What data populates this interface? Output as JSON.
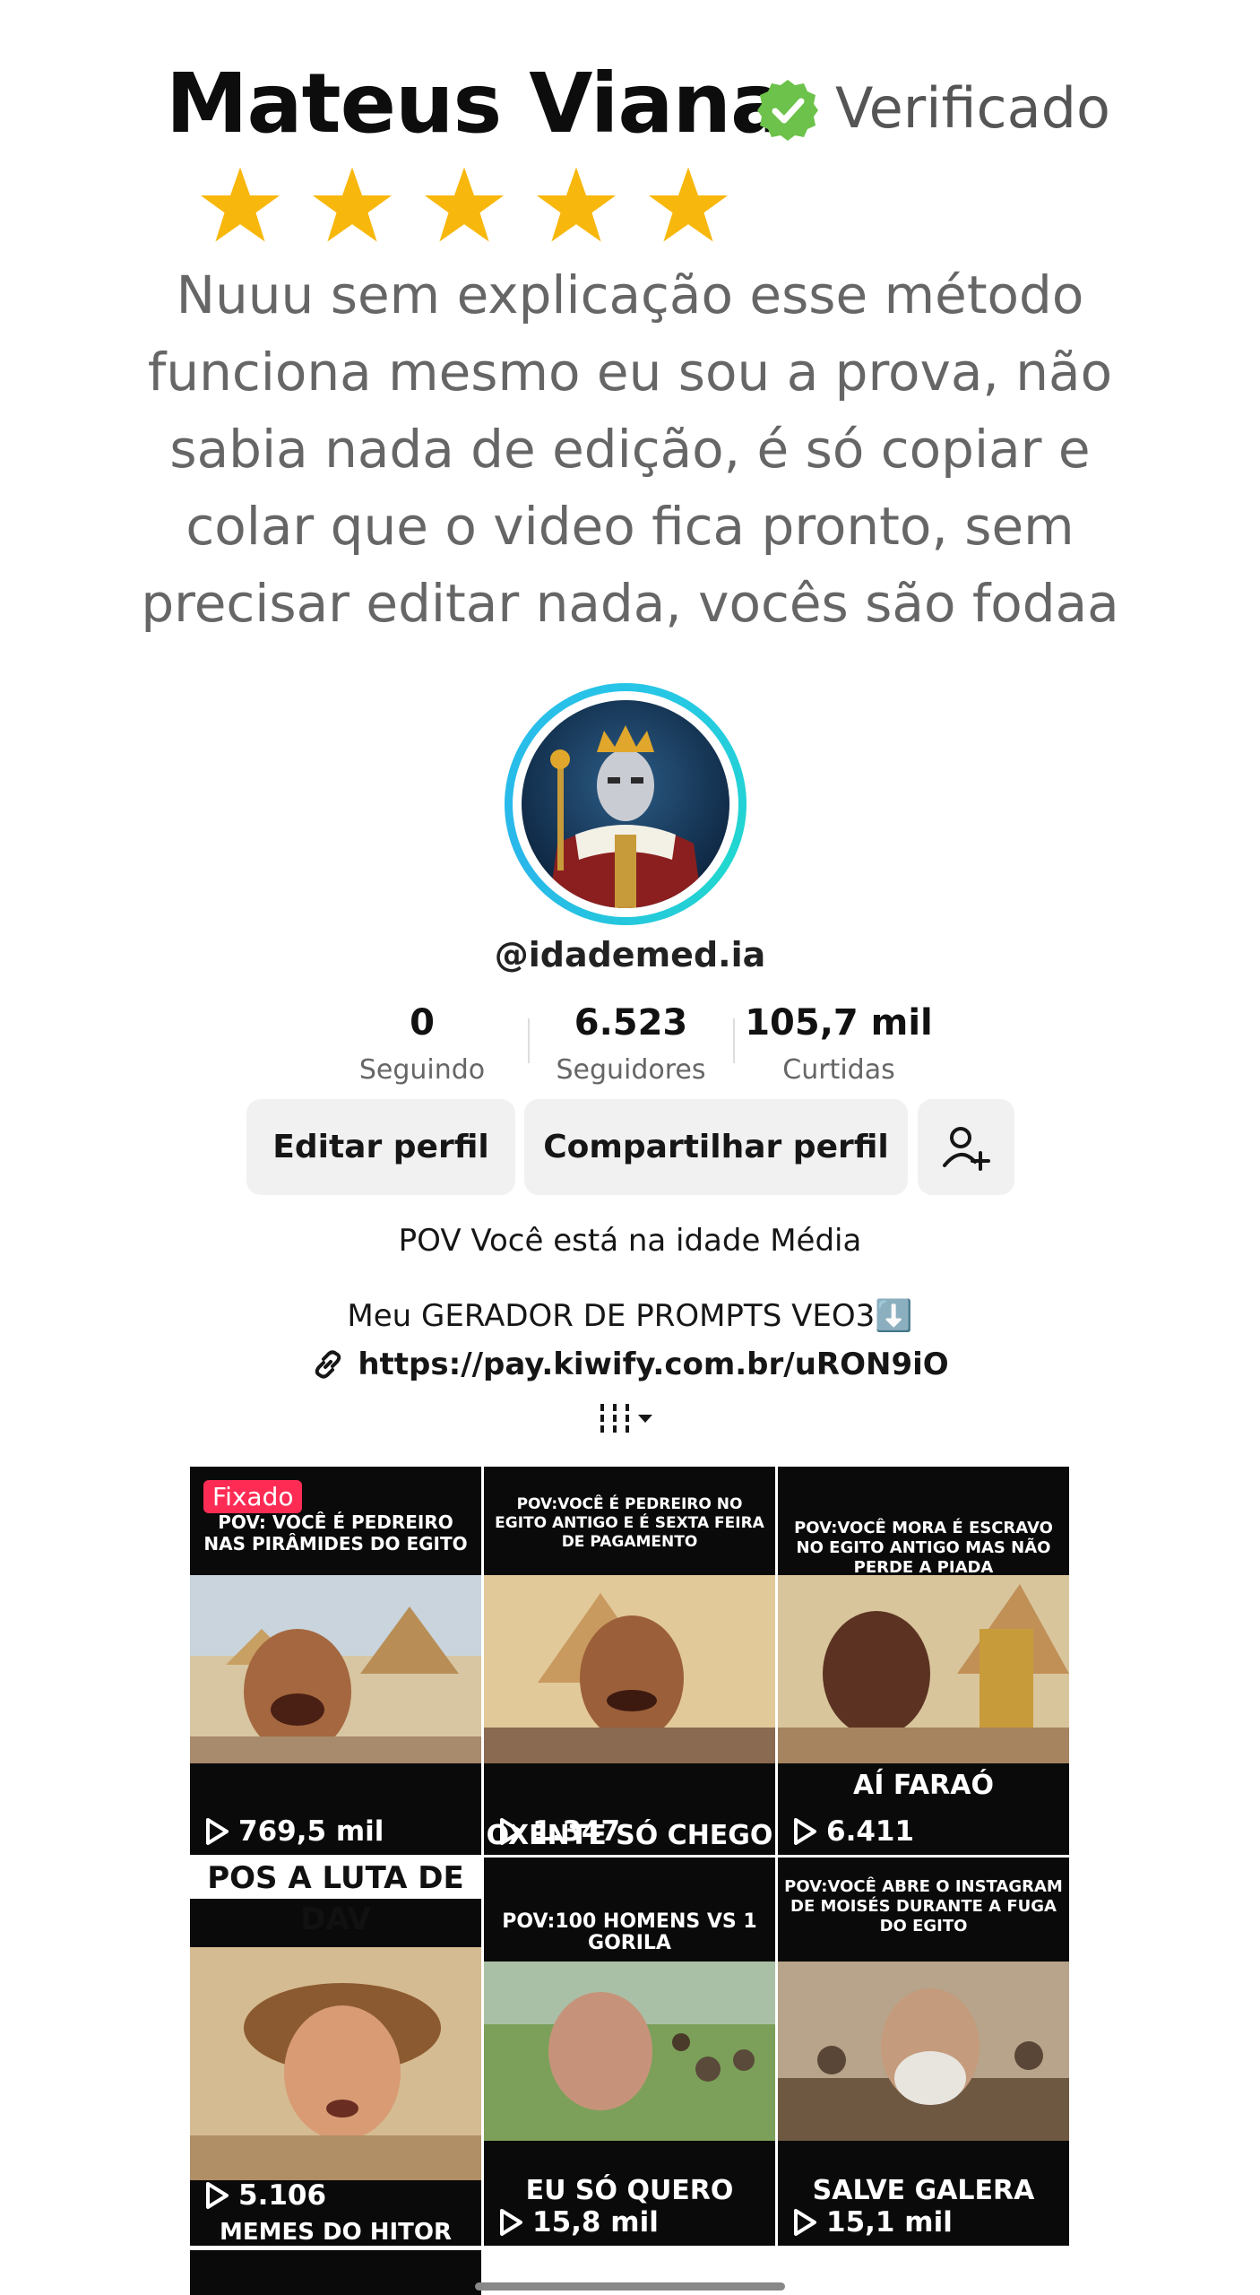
{
  "testimonial": {
    "name": "Mateus Viana",
    "verified_label": "Verificado",
    "stars": 5,
    "quote": "Nuuu sem explicação esse método funciona mesmo eu sou a prova, não sabia nada de edição, é só copiar e colar que o video fica pronto, sem precisar editar nada, vocês são fodaa"
  },
  "profile": {
    "handle": "@idademed.ia",
    "stats": [
      {
        "value": "0",
        "label": "Seguindo"
      },
      {
        "value": "6.523",
        "label": "Seguidores"
      },
      {
        "value": "105,7 mil",
        "label": "Curtidas"
      }
    ],
    "edit_label": "Editar perfil",
    "share_label": "Compartilhar perfil",
    "bio_line1": "POV Você está na idade Média",
    "bio_line2": "Meu GERADOR DE PROMPTS VEO3⬇️",
    "link": "https://pay.kiwify.com.br/uRON9iO"
  },
  "videos": [
    {
      "pinned": "Fixado",
      "caption": "POV: VOCÊ É PEDREIRO NAS PIRÂMIDES DO EGITO",
      "overlay": "",
      "views": "769,5 mil"
    },
    {
      "caption": "POV:VOCÊ É PEDREIRO NO EGITO ANTIGO E É SEXTA FEIRA DE PAGAMENTO",
      "overlay": "OXENTE SÓ CHEGO",
      "views": "1.347"
    },
    {
      "caption": "POV:VOCÊ MORA É ESCRAVO NO EGITO ANTIGO MAS NÃO PERDE A PIADA",
      "overlay": "AÍ FARAÓ",
      "views": "6.411"
    },
    {
      "caption": "POS A LUTA DE DAV",
      "overlay": "MEMES DO HITOR",
      "views": "5.106"
    },
    {
      "caption": "POV:100 HOMENS VS 1 GORILA",
      "overlay": "EU SÓ QUERO",
      "views": "15,8 mil"
    },
    {
      "caption": "POV:VOCÊ ABRE O INSTAGRAM DE MOISÉS DURANTE A FUGA DO EGITO",
      "overlay": "SALVE GALERA",
      "views": "15,1 mil"
    }
  ],
  "colors": {
    "verified": "#6cc24a",
    "star": "#f8b70c",
    "ring": "#24c7e3",
    "pin": "#fe2c55"
  }
}
